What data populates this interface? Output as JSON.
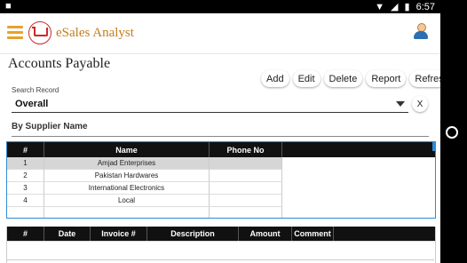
{
  "status_bar": {
    "time": "6:57",
    "left_icon": "notification-square",
    "icons": [
      "wifi",
      "signal",
      "battery"
    ]
  },
  "app_bar": {
    "title": "eSales Analyst",
    "menu_icon": "hamburger-menu",
    "logo_icon": "shopping-cart-logo",
    "profile_icon": "user-avatar"
  },
  "page": {
    "title": "Accounts Payable"
  },
  "toolbar": {
    "buttons": [
      "Add",
      "Edit",
      "Delete",
      "Report",
      "Refresh"
    ]
  },
  "search": {
    "legend": "Search Record",
    "selected": "Overall",
    "clear_label": "X"
  },
  "filter": {
    "label": "By Supplier Name"
  },
  "supplier_table": {
    "columns": [
      "#",
      "Name",
      "Phone No"
    ],
    "rows": [
      {
        "num": "1",
        "name": "Amjad Enterprises",
        "phone": ""
      },
      {
        "num": "2",
        "name": "Pakistan Hardwares",
        "phone": ""
      },
      {
        "num": "3",
        "name": "International Electronics",
        "phone": ""
      },
      {
        "num": "4",
        "name": "Local",
        "phone": ""
      }
    ]
  },
  "transactions_table": {
    "columns": [
      "#",
      "Date",
      "Invoice #",
      "Description",
      "Amount",
      "Comment"
    ]
  },
  "colors": {
    "accent_orange": "#e8a12b",
    "title_brown": "#c47c1a",
    "table_header": "#111111",
    "selection_blue": "#2e8bd6"
  }
}
